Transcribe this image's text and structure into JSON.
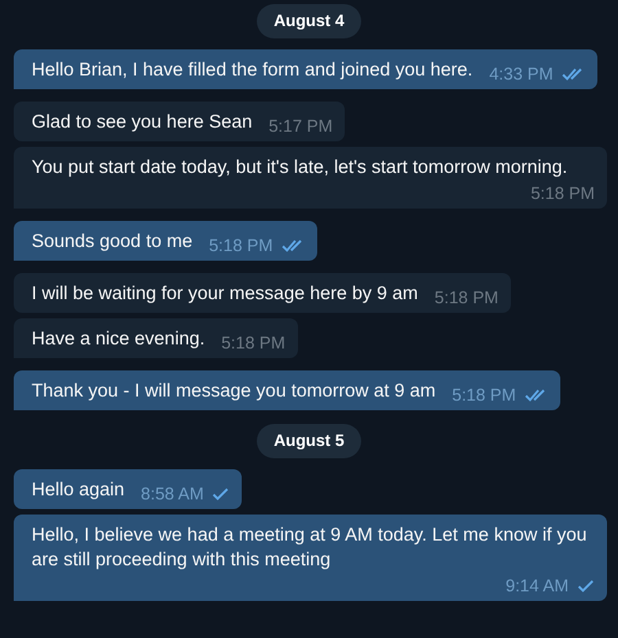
{
  "items": [
    {
      "kind": "date",
      "label": "August 4"
    },
    {
      "kind": "outgoing",
      "text": "Hello Brian, I have filled the form and joined you here.",
      "time": "4:33 PM",
      "read": true
    },
    {
      "kind": "incoming",
      "text": "Glad to see you here Sean",
      "time": "5:17 PM"
    },
    {
      "kind": "incoming",
      "text": "You put start date today, but it's late, let's start tomorrow morning.",
      "time": "5:18 PM"
    },
    {
      "kind": "outgoing",
      "text": "Sounds good to me",
      "time": "5:18 PM",
      "read": true
    },
    {
      "kind": "incoming",
      "text": "I will be waiting for your message here by 9 am",
      "time": "5:18 PM"
    },
    {
      "kind": "incoming",
      "text": "Have a nice evening.",
      "time": "5:18 PM"
    },
    {
      "kind": "outgoing",
      "text": "Thank you - I will message you tomorrow at 9 am",
      "time": "5:18 PM",
      "read": true
    },
    {
      "kind": "date",
      "label": "August 5"
    },
    {
      "kind": "outgoing",
      "text": "Hello again",
      "time": "8:58 AM",
      "read": false
    },
    {
      "kind": "outgoing",
      "text": "Hello, I believe we had a meeting at 9 AM today. Let me know if you are still proceeding with this meeting",
      "time": "9:14 AM",
      "read": false
    }
  ]
}
